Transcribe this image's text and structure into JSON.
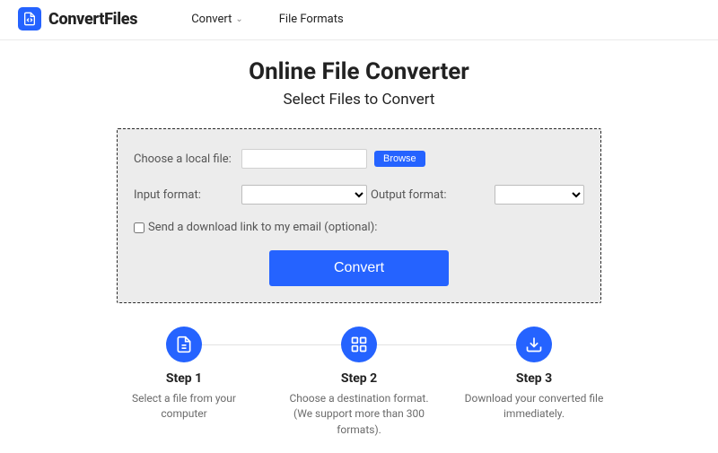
{
  "brand": "ConvertFiles",
  "nav": {
    "convert": "Convert",
    "formats": "File Formats"
  },
  "hero": {
    "title": "Online File Converter",
    "subtitle": "Select Files to Convert"
  },
  "form": {
    "choose_label": "Choose a local file:",
    "browse": "Browse",
    "input_label": "Input format:",
    "output_label": "Output format:",
    "email_label": "Send a download link to my email (optional):",
    "convert": "Convert"
  },
  "steps": [
    {
      "title": "Step 1",
      "desc": "Select a file from your computer"
    },
    {
      "title": "Step 2",
      "desc": "Choose a destination format. (We support more than 300 formats)."
    },
    {
      "title": "Step 3",
      "desc": "Download your converted file immediately."
    }
  ]
}
